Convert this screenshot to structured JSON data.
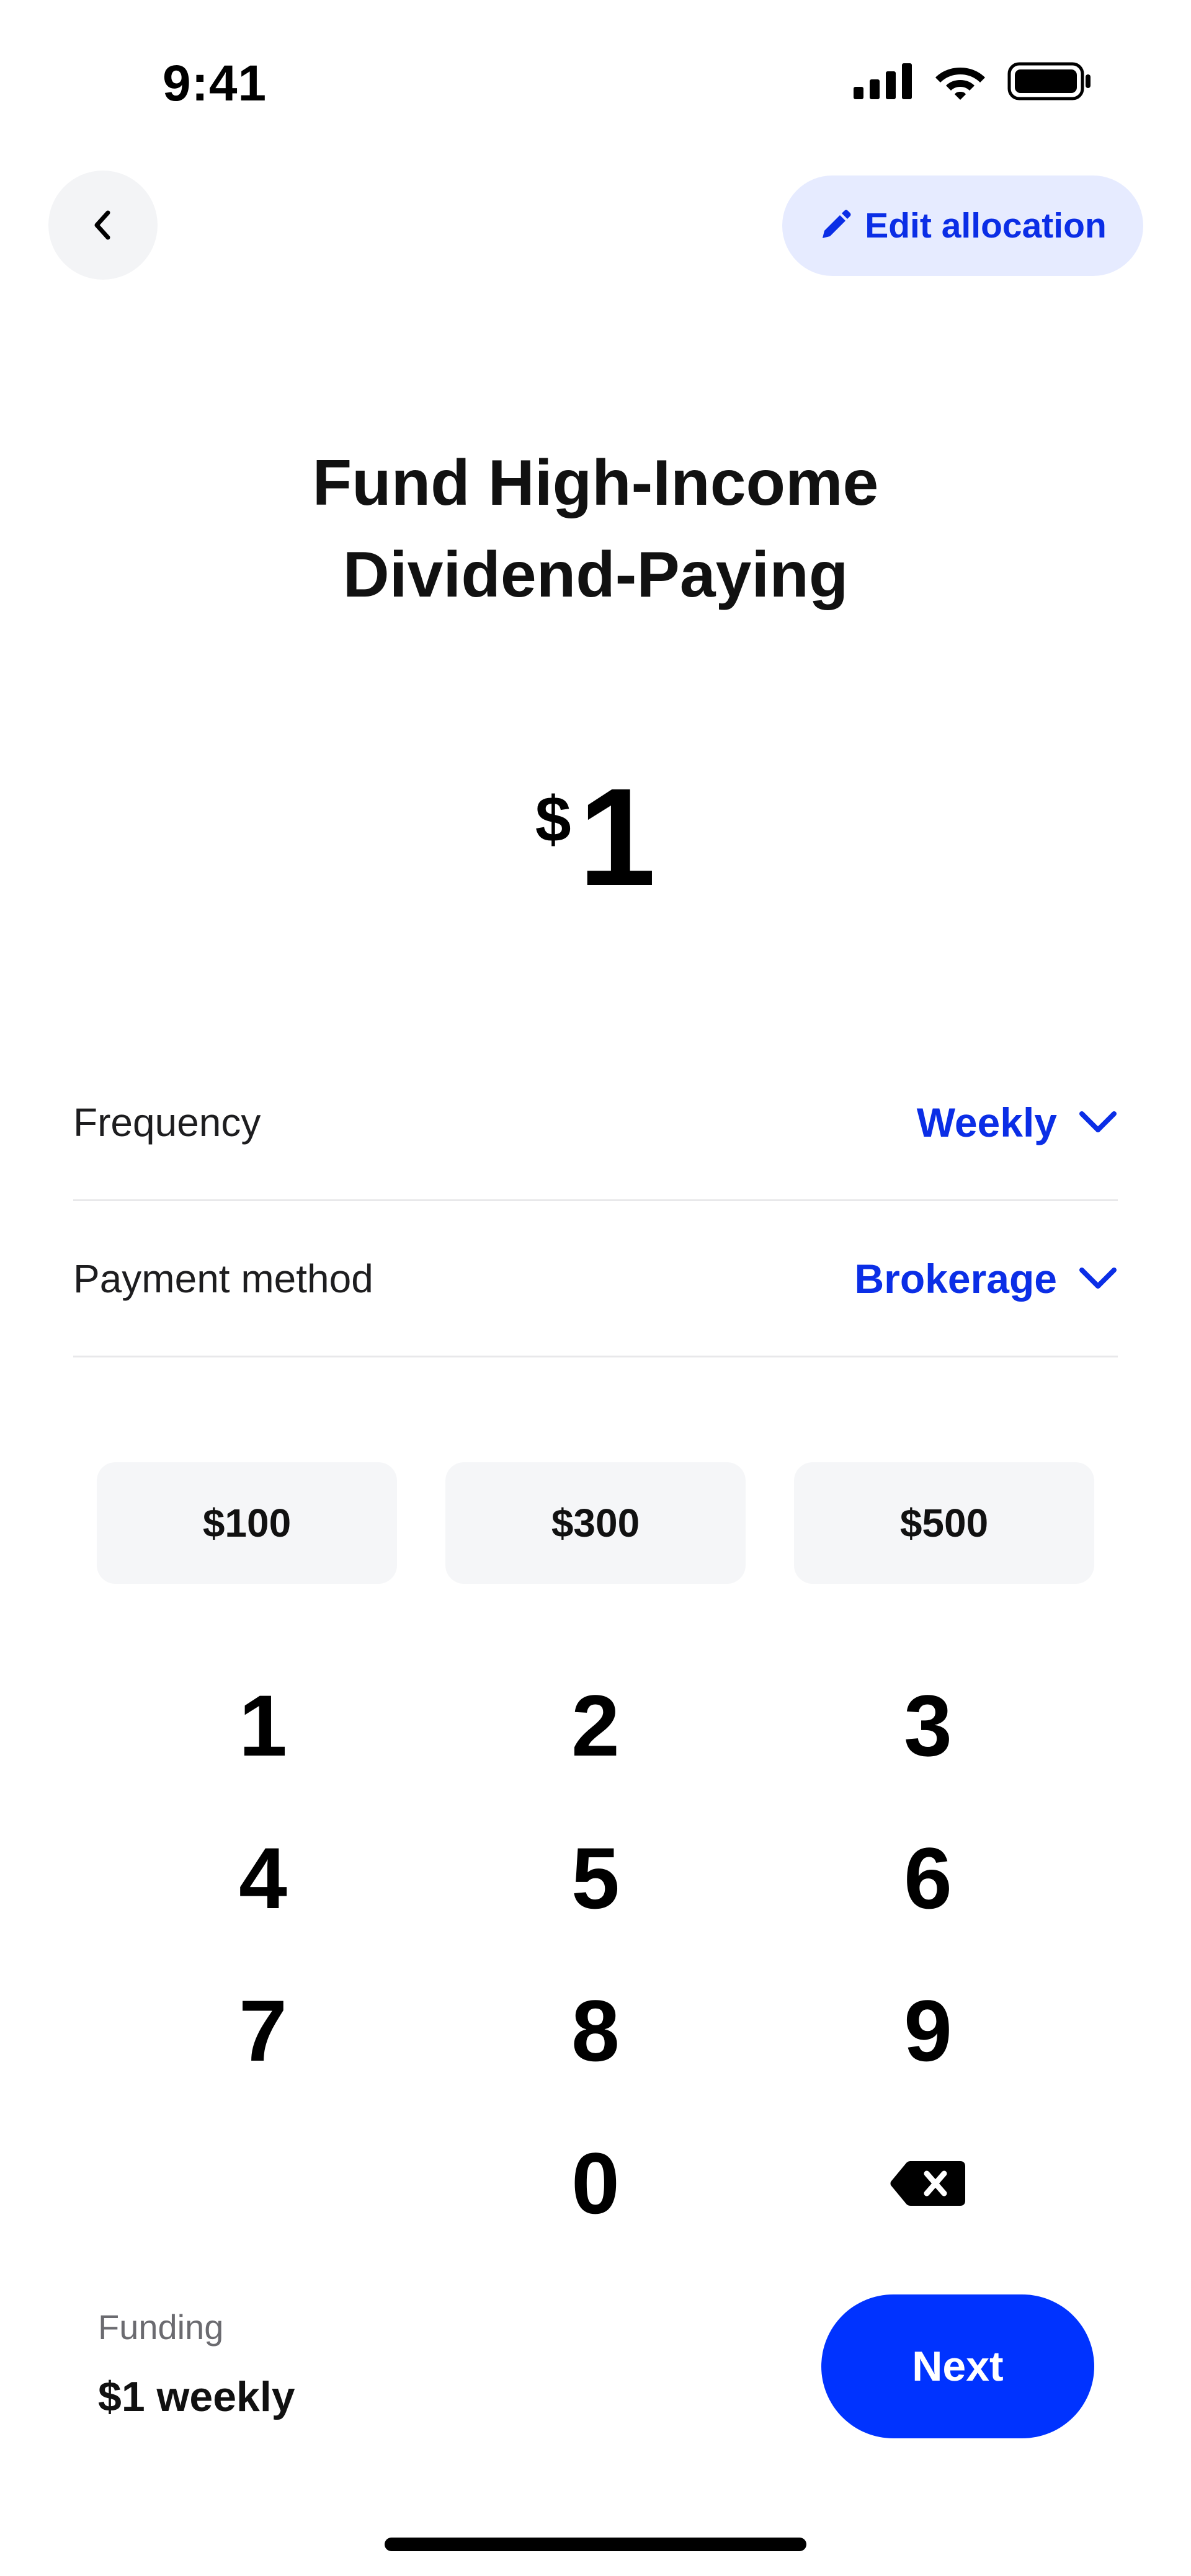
{
  "status_bar": {
    "time": "9:41"
  },
  "header": {
    "back_icon": "chevron-left-icon",
    "edit_allocation_label": "Edit allocation",
    "edit_icon": "pencil-icon"
  },
  "title": {
    "line1": "Fund High-Income",
    "line2": "Dividend-Paying"
  },
  "amount": {
    "currency": "$",
    "value": "1"
  },
  "frequency": {
    "label": "Frequency",
    "value": "Weekly"
  },
  "payment_method": {
    "label": "Payment method",
    "value": "Brokerage"
  },
  "presets": [
    "$100",
    "$300",
    "$500"
  ],
  "keypad": {
    "keys": [
      "1",
      "2",
      "3",
      "4",
      "5",
      "6",
      "7",
      "8",
      "9",
      "0"
    ],
    "delete_icon": "backspace-icon"
  },
  "footer": {
    "funding_label": "Funding",
    "funding_value": "$1 weekly",
    "next_label": "Next"
  },
  "colors": {
    "accent": "#0033ff",
    "accent_text": "#0b2ee6",
    "chip_bg": "#f5f6f8",
    "edit_bg": "#e6ebff"
  }
}
